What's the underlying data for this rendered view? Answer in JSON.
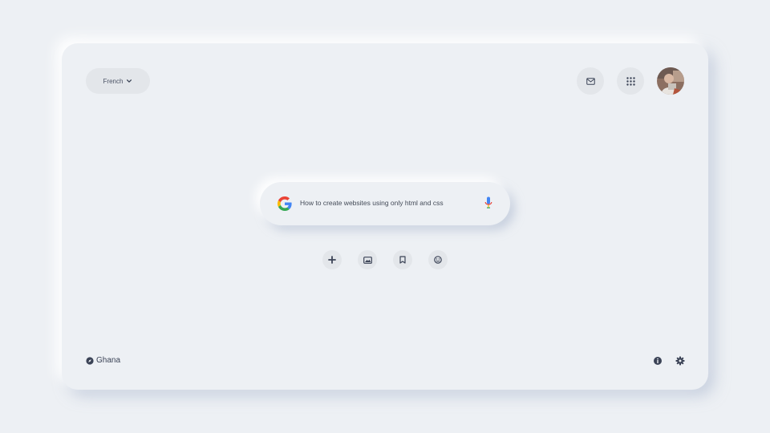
{
  "header": {
    "language_label": "French",
    "mail_icon": "mail-icon",
    "apps_icon": "apps-grid-icon",
    "avatar": "user-avatar"
  },
  "search": {
    "value": "How to create websites using only html and css",
    "logo": "google-g-icon",
    "mic_icon": "microphone-icon"
  },
  "actions": [
    {
      "icon": "plus-icon"
    },
    {
      "icon": "image-icon"
    },
    {
      "icon": "bookmark-icon"
    },
    {
      "icon": "smiley-icon"
    }
  ],
  "footer": {
    "location": "Ghana",
    "location_icon": "compass-icon",
    "info_icon": "info-icon",
    "settings_icon": "settings-icon"
  },
  "colors": {
    "background": "#edf0f4",
    "button": "#e3e6ea",
    "icon": "#3b4356"
  }
}
